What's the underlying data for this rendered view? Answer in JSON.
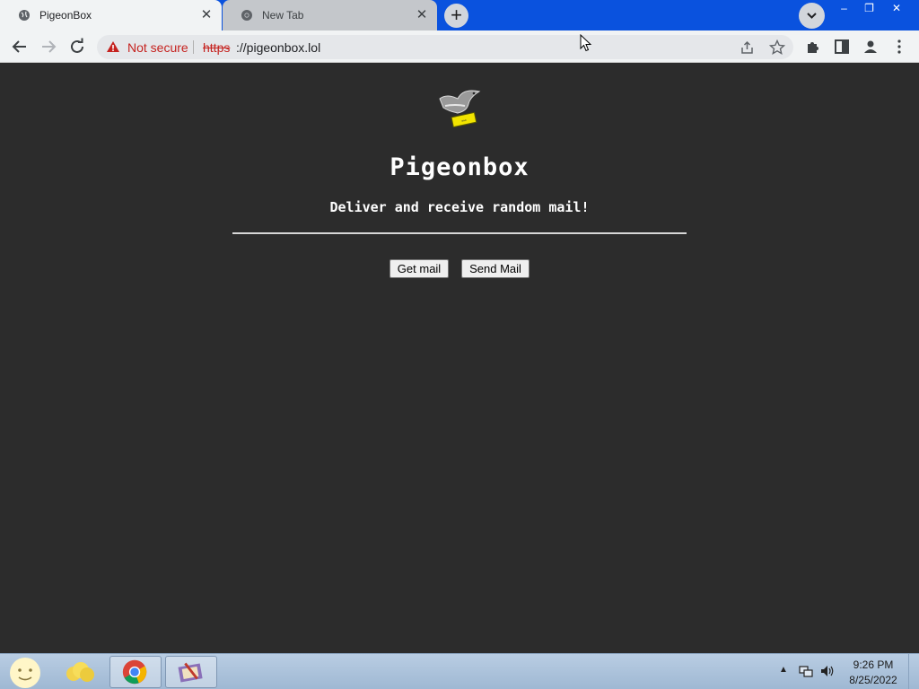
{
  "browser": {
    "tabs": [
      {
        "title": "PigeonBox",
        "active": true
      },
      {
        "title": "New Tab",
        "active": false
      }
    ],
    "new_tab_label": "+",
    "address_bar": {
      "security_text": "Not secure",
      "url_scheme": "https",
      "url_rest": "://pigeonbox.lol"
    },
    "window_controls": {
      "minimize": "–",
      "maximize": "❐",
      "close": "✕"
    }
  },
  "page": {
    "title": "Pigeonbox",
    "tagline": "Deliver and receive random mail!",
    "buttons": {
      "get_mail": "Get mail",
      "send_mail": "Send Mail"
    }
  },
  "taskbar": {
    "time": "9:26 PM",
    "date": "8/25/2022",
    "items": [
      "start",
      "file-explorer",
      "chrome",
      "paint"
    ]
  },
  "colors": {
    "titlebar": "#0a52de",
    "page_background": "#2c2c2c",
    "not_secure": "#c5221f"
  }
}
